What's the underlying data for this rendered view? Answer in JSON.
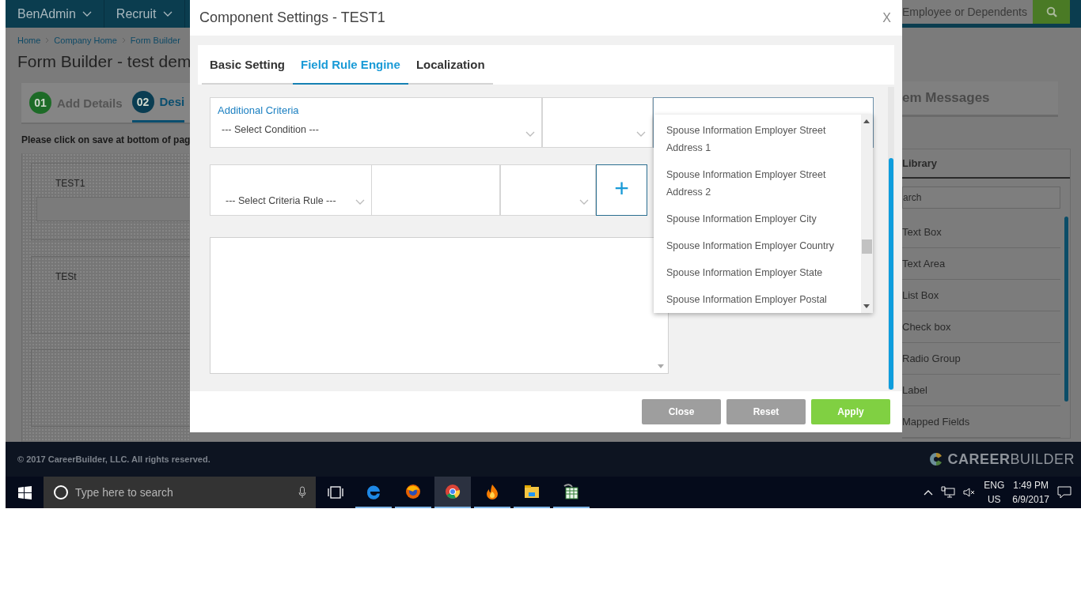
{
  "header": {
    "menus": [
      {
        "label": "BenAdmin"
      },
      {
        "label": "Recruit"
      }
    ],
    "search": {
      "placeholder": "Employee or Dependents"
    }
  },
  "breadcrumbs": [
    "Home",
    "Company Home",
    "Form Builder"
  ],
  "page_title": "Form Builder - test dem",
  "steps": [
    {
      "number": "01",
      "label": "Add Details",
      "selected": false
    },
    {
      "number": "02",
      "label": "Desi",
      "selected": true
    }
  ],
  "hint": "Please click on save at bottom of pag",
  "canvas": {
    "fields": [
      {
        "label": "TEST1",
        "kind": "input"
      },
      {
        "label": "TESt",
        "kind": "blank"
      },
      {
        "kind": "blank"
      }
    ]
  },
  "right_tab": {
    "label": "em Messages"
  },
  "library": {
    "title": "Library",
    "search": {
      "placeholder": "arch"
    },
    "items": [
      "Text Box",
      "Text Area",
      "List Box",
      "Check box",
      "Radio Group",
      "Label",
      "Mapped Fields"
    ]
  },
  "footer": {
    "copyright": "© 2017 CareerBuilder, LLC. All rights reserved.",
    "logo": "**CAREER**BUILDER"
  },
  "dialog": {
    "title": "Component Settings - TEST1",
    "close": "X",
    "tabs": [
      {
        "label": "Basic Setting",
        "selected": false
      },
      {
        "label": "Field Rule Engine",
        "selected": true
      },
      {
        "label": "Localization",
        "selected": false
      }
    ],
    "criteria": {
      "label": "Additional Criteria",
      "condition": "--- Select Condition ---"
    },
    "criteria_rule": "--- Select Criteria Rule ---",
    "add": "+",
    "dropdown": {
      "options": [
        "Spouse Information Employer Street Address 1",
        "Spouse Information Employer Street Address 2",
        "Spouse Information Employer City",
        "Spouse Information Employer Country",
        "Spouse Information Employer State",
        "Spouse Information Employer Postal"
      ]
    },
    "buttons": [
      {
        "label": "Close",
        "kind": "neutral"
      },
      {
        "label": "Reset",
        "kind": "neutral"
      },
      {
        "label": "Apply",
        "kind": "primary"
      }
    ]
  },
  "taskbar": {
    "search": {
      "placeholder": "Type here to search"
    },
    "apps": [
      {
        "running": true,
        "selected": false
      },
      {
        "running": true,
        "selected": false
      },
      {
        "running": true,
        "selected": true
      },
      {
        "running": true,
        "selected": false
      },
      {
        "running": true,
        "selected": false
      },
      {
        "running": true,
        "selected": false
      }
    ],
    "language": [
      "ENG",
      "US"
    ],
    "time": "1:49 PM",
    "date": "6/9/2017"
  }
}
